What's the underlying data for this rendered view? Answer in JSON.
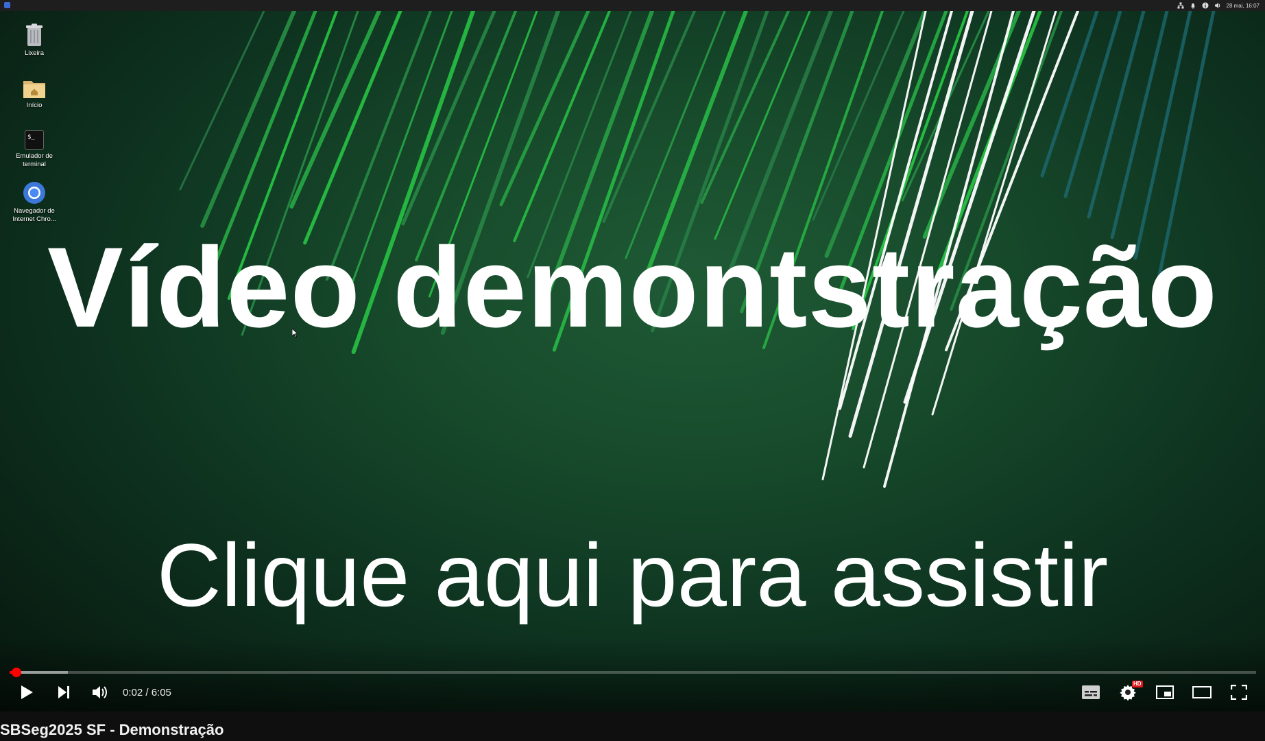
{
  "desktop": {
    "topbar_clock": "28 mai, 16:07",
    "icons": [
      {
        "label": "Lixeira",
        "icon": "trash-icon"
      },
      {
        "label": "Início",
        "icon": "home-folder-icon"
      },
      {
        "label": "Emulador de terminal",
        "icon": "terminal-icon"
      },
      {
        "label": "Navegador de Internet Chro...",
        "icon": "chromium-icon"
      }
    ]
  },
  "video": {
    "headline": "Vídeo demontstração",
    "call_to_action": "Clique aqui para assistir",
    "progress": {
      "played_fraction": 0.0055,
      "buffered_fraction": 0.047
    },
    "time": "0:02 / 6:05",
    "hd_badge": "HD",
    "controls": {
      "play": "play-icon",
      "next": "next-icon",
      "volume": "volume-icon",
      "subtitles": "subtitles-icon",
      "settings": "gear-icon",
      "miniplayer": "miniplayer-icon",
      "theater": "theater-mode-icon",
      "fullscreen": "fullscreen-icon"
    },
    "colors": {
      "accent": "#ff0000",
      "background": "#0e3320"
    }
  },
  "page": {
    "video_title": "SBSeg2025 SF - Demonstração"
  }
}
